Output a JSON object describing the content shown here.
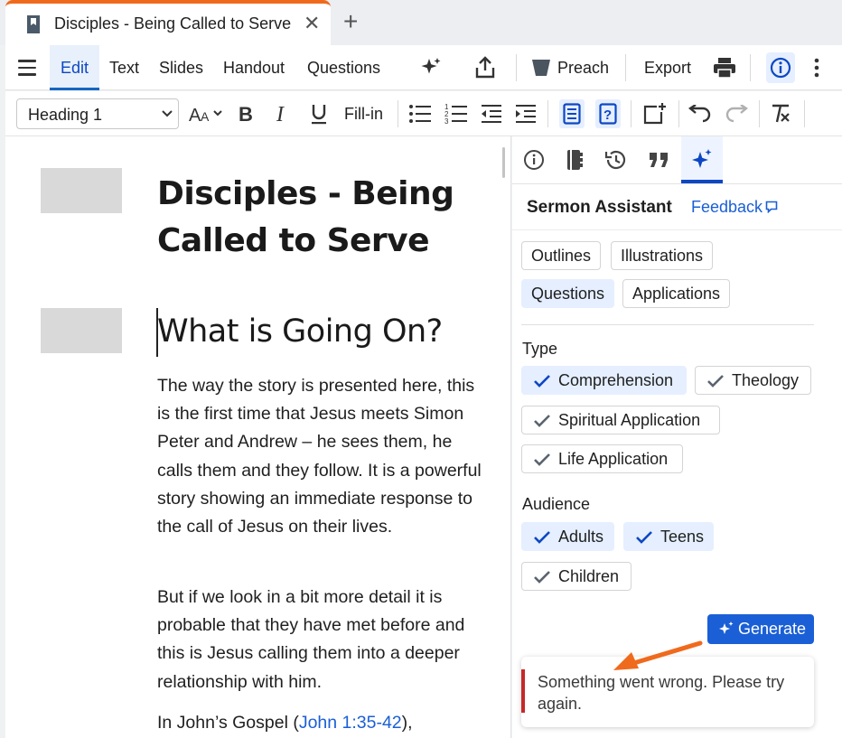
{
  "tab": {
    "title": "Disciples - Being Called to Serve",
    "close": "✕",
    "new": "+"
  },
  "toolbar": {
    "modes": [
      "Edit",
      "Text",
      "Slides",
      "Handout",
      "Questions"
    ],
    "preach": "Preach",
    "export": "Export"
  },
  "format": {
    "style_value": "Heading 1",
    "fill_in": "Fill-in"
  },
  "document": {
    "title": "Disciples - Being Called to Serve",
    "heading": "What is Going On?",
    "para1": "The way the story is presented here, this is the first time that Jesus meets Simon Peter and Andrew – he sees them, he calls them and they follow. It is a powerful story showing an immediate response to the call of Jesus on their lives.",
    "para2": "But if we look in a bit more detail it is probable that they have met before and this is Jesus calling them into a deeper relationship with him.",
    "para3_prefix": "In John’s Gospel (",
    "para3_link": "John 1:35-42",
    "para3_suffix": "),"
  },
  "panel": {
    "title": "Sermon Assistant",
    "feedback": "Feedback",
    "categories": [
      "Outlines",
      "Illustrations",
      "Questions",
      "Applications"
    ],
    "selected_category": "Questions",
    "type_label": "Type",
    "types": [
      "Comprehension",
      "Theology",
      "Spiritual Application",
      "Life Application"
    ],
    "audience_label": "Audience",
    "audiences": [
      "Adults",
      "Teens",
      "Children"
    ],
    "generate": "Generate",
    "error": "Something went wrong. Please try again."
  },
  "colors": {
    "accent": "#1a5fd6",
    "tab_accent": "#f06a1d",
    "error": "#c62828",
    "arrow": "#f06a1d",
    "chip_selected": "#e5efff"
  }
}
